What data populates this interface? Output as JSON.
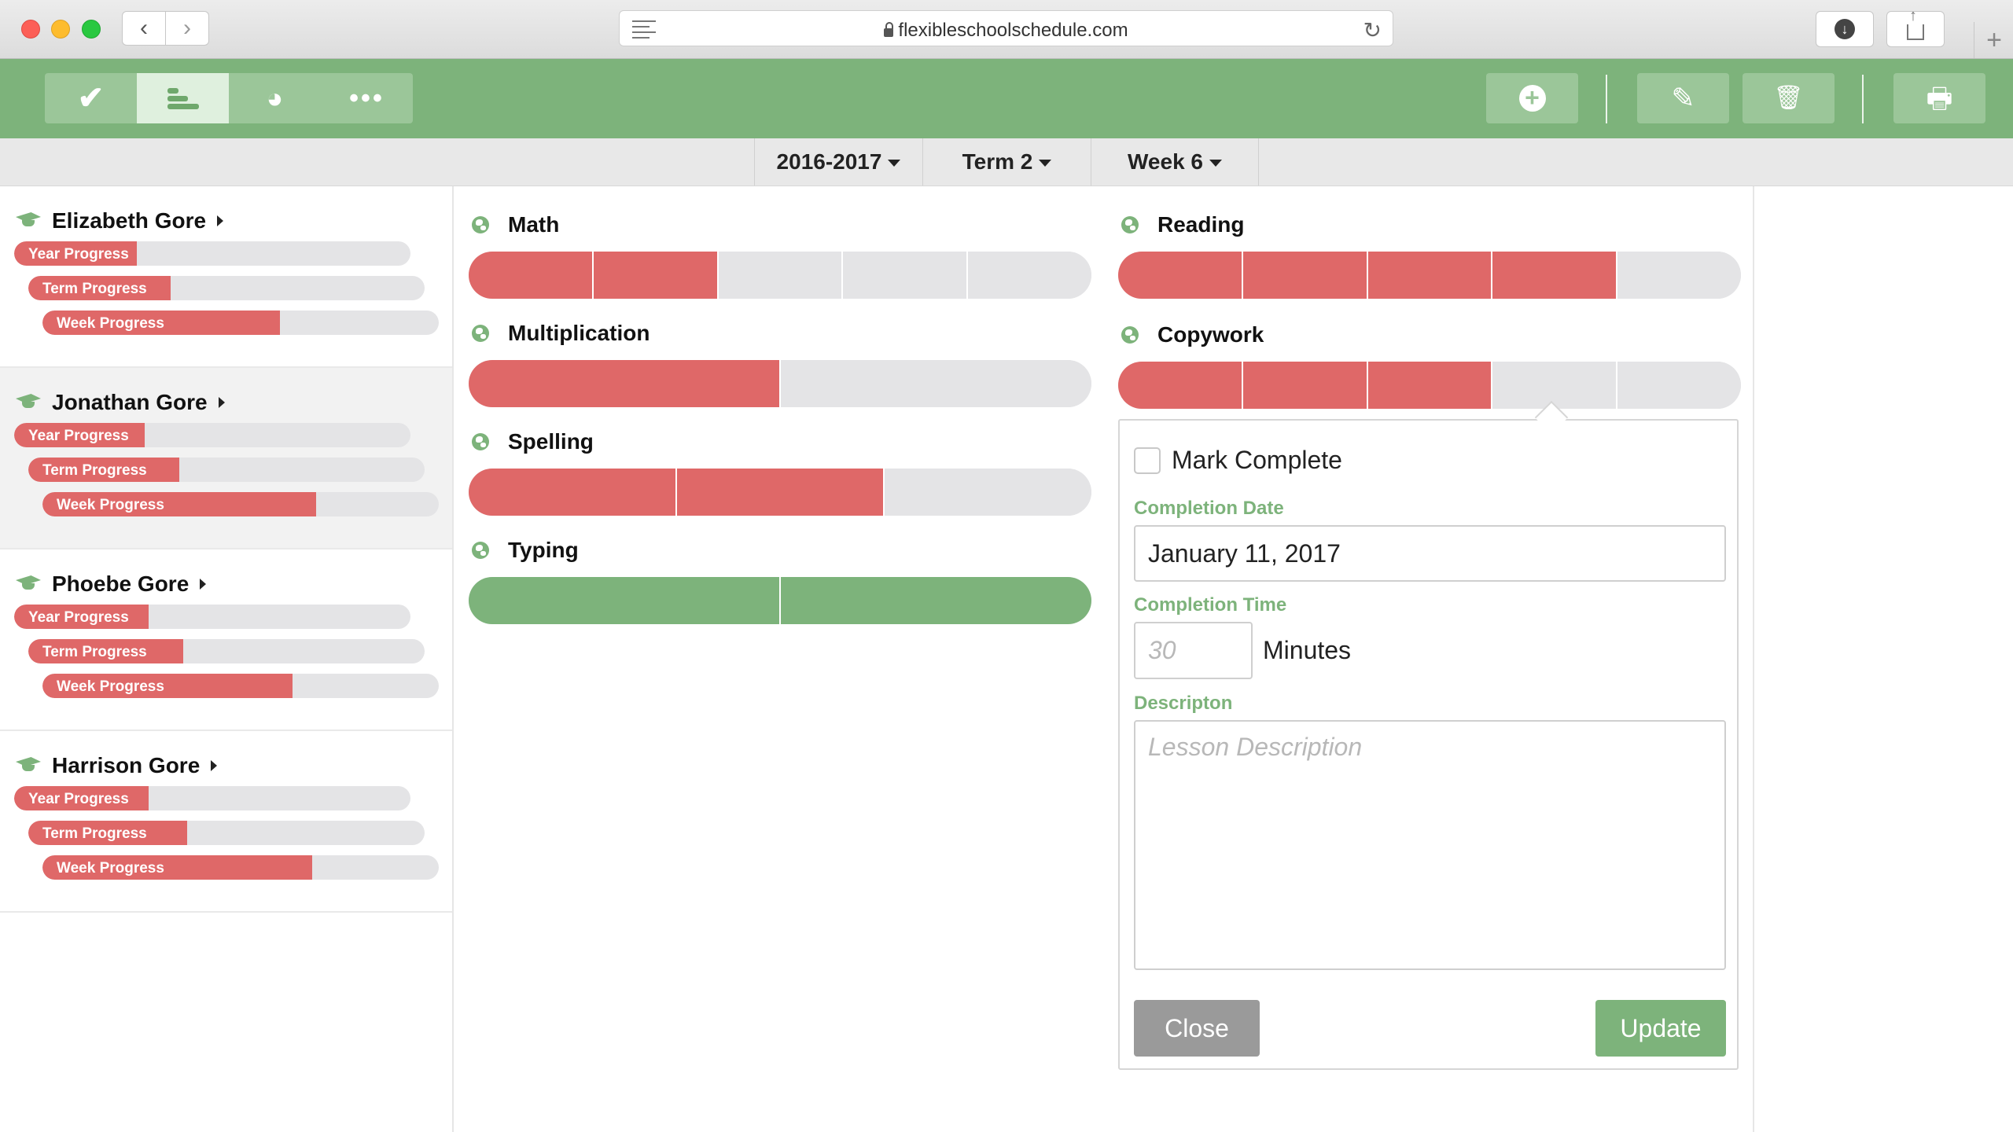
{
  "browser": {
    "url": "flexibleschoolschedule.com",
    "back_glyph": "‹",
    "forward_glyph": "›",
    "reload_glyph": "↻",
    "download_glyph": "↓",
    "new_tab_glyph": "+"
  },
  "toolbar": {
    "views": [
      {
        "name": "complete",
        "icon": "check-icon",
        "glyph": "✔"
      },
      {
        "name": "progress",
        "icon": "bars-icon"
      },
      {
        "name": "chart",
        "icon": "pie-chart-icon",
        "glyph": "◕"
      },
      {
        "name": "more",
        "icon": "ellipsis-icon",
        "glyph": "•••"
      }
    ],
    "actions": [
      {
        "name": "add",
        "icon": "plus-circle-icon",
        "glyph": "+"
      },
      {
        "name": "edit",
        "icon": "pencil-icon",
        "glyph": "✎"
      },
      {
        "name": "delete",
        "icon": "trash-icon",
        "glyph": "🗑"
      },
      {
        "name": "print",
        "icon": "printer-icon",
        "glyph": "🖶"
      }
    ],
    "active_view": "progress"
  },
  "filters": {
    "year": "2016-2017",
    "term": "Term 2",
    "week": "Week 6"
  },
  "students": [
    {
      "name": "Elizabeth Gore",
      "year_label": "Year Progress",
      "year": 0.31,
      "term_label": "Term Progress",
      "term": 0.36,
      "week_label": "Week Progress",
      "week": 0.6
    },
    {
      "name": "Jonathan Gore",
      "year_label": "Year Progress",
      "year": 0.33,
      "term_label": "Term Progress",
      "term": 0.38,
      "week_label": "Week Progress",
      "week": 0.69
    },
    {
      "name": "Phoebe Gore",
      "year_label": "Year Progress",
      "year": 0.34,
      "term_label": "Term Progress",
      "term": 0.39,
      "week_label": "Week Progress",
      "week": 0.63
    },
    {
      "name": "Harrison Gore",
      "year_label": "Year Progress",
      "year": 0.34,
      "term_label": "Term Progress",
      "term": 0.4,
      "week_label": "Week Progress",
      "week": 0.68
    }
  ],
  "subjects": [
    {
      "name": "Math",
      "segments": 5,
      "completed": 2,
      "color": "red"
    },
    {
      "name": "Multiplication",
      "segments": 2,
      "completed": 1,
      "color": "red"
    },
    {
      "name": "Spelling",
      "segments": 3,
      "completed": 2,
      "color": "red"
    },
    {
      "name": "Typing",
      "segments": 2,
      "completed": 2,
      "color": "green"
    },
    {
      "name": "Reading",
      "segments": 5,
      "completed": 4,
      "color": "red"
    },
    {
      "name": "Copywork",
      "segments": 5,
      "completed": 3,
      "color": "red"
    }
  ],
  "popover": {
    "mark_complete_label": "Mark Complete",
    "completion_date_label": "Completion Date",
    "completion_date_value": "January 11, 2017",
    "completion_time_label": "Completion Time",
    "minutes_placeholder": "30",
    "minutes_label": "Minutes",
    "description_label": "Descripton",
    "description_placeholder": "Lesson Description",
    "close_label": "Close",
    "update_label": "Update"
  },
  "colors": {
    "brand_green": "#7db37b",
    "progress_red": "#df6868",
    "track_gray": "#e4e4e6"
  }
}
